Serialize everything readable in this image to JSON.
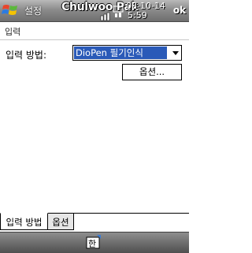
{
  "titlebar": {
    "app_title": "설정",
    "owner_name": "Chulwoo Pak",
    "date": "08-10-14",
    "time": "5:59",
    "ok_label": "ok"
  },
  "page": {
    "title": "입력"
  },
  "form": {
    "input_method_label": "입력 방법:",
    "input_method_value": "DioPen 필기인식",
    "options_button": "옵션..."
  },
  "tabs": [
    {
      "label": "입력 방법",
      "active": true
    },
    {
      "label": "옵션",
      "active": false
    }
  ],
  "icons": {
    "start": "windows-flag-icon",
    "connectivity": "connectivity-icon",
    "signal": "signal-icon",
    "sip": "keyboard-icon"
  },
  "colors": {
    "selection": "#2a5ab8",
    "titlebar": "#8c8c8c"
  }
}
